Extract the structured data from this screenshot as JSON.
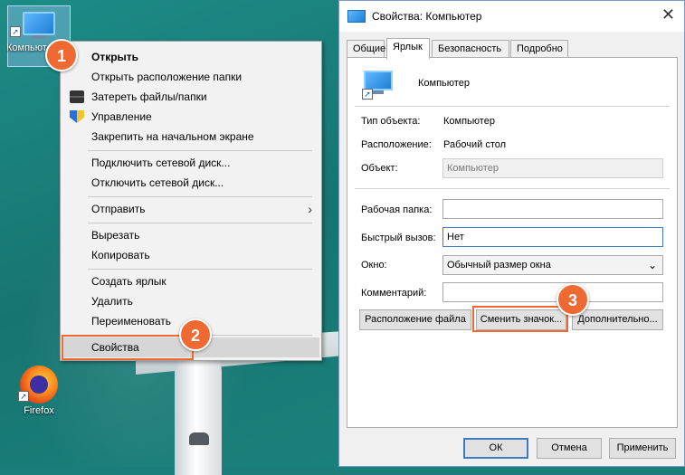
{
  "desktop": {
    "icons": [
      {
        "label": "Компьютер"
      },
      {
        "label": "Firefox"
      }
    ]
  },
  "context_menu": {
    "items": [
      {
        "label": "Открыть",
        "icon": "none"
      },
      {
        "label": "Открыть расположение папки",
        "icon": "none"
      },
      {
        "label": "Затереть файлы/папки",
        "icon": "shredder-icon"
      },
      {
        "label": "Управление",
        "icon": "shield-icon"
      },
      {
        "label": "Закрепить на начальном экране",
        "icon": "none"
      },
      {
        "label": "Подключить сетевой диск...",
        "icon": "none"
      },
      {
        "label": "Отключить сетевой диск...",
        "icon": "none"
      },
      {
        "label": "Отправить",
        "icon": "chevron-right-icon"
      },
      {
        "label": "Вырезать",
        "icon": "none"
      },
      {
        "label": "Копировать",
        "icon": "none"
      },
      {
        "label": "Создать ярлык",
        "icon": "none"
      },
      {
        "label": "Удалить",
        "icon": "none"
      },
      {
        "label": "Переименовать",
        "icon": "none"
      },
      {
        "label": "Свойства",
        "icon": "none"
      }
    ]
  },
  "steps": {
    "one": "1",
    "two": "2",
    "three": "3"
  },
  "dialog": {
    "title": "Свойства: Компьютер",
    "tabs": [
      "Общие",
      "Ярлык",
      "Безопасность",
      "Подробно"
    ],
    "active_tab": "Ярлык",
    "item_name": "Компьютер",
    "object_type_label": "Тип объекта:",
    "object_type_value": "Компьютер",
    "location_label": "Расположение:",
    "location_value": "Рабочий стол",
    "target_label": "Объект:",
    "target_value": "Компьютер",
    "workdir_label": "Рабочая папка:",
    "workdir_value": "",
    "hotkey_label": "Быстрый вызов:",
    "hotkey_value": "Нет",
    "window_label": "Окно:",
    "window_value": "Обычный размер окна",
    "comment_label": "Комментарий:",
    "comment_value": "",
    "btn_file_location": "Расположение файла",
    "btn_change_icon": "Сменить значок...",
    "btn_advanced": "Дополнительно...",
    "btn_ok": "ОК",
    "btn_cancel": "Отмена",
    "btn_apply": "Применить"
  },
  "colors": {
    "accent": "#ef6a33",
    "focus": "#3d7bc2",
    "desktop": "#1a7d7a"
  }
}
